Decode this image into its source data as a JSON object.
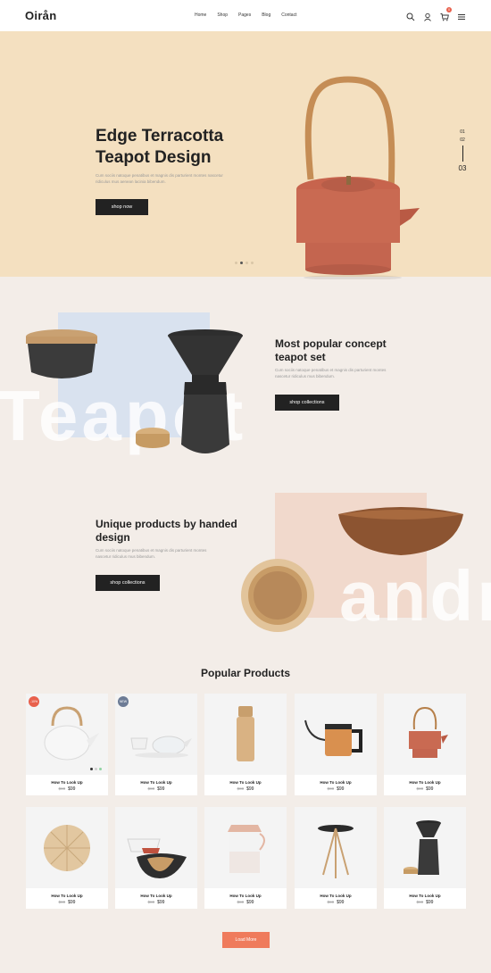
{
  "header": {
    "logo": "Oirån",
    "nav": [
      "Home",
      "Shop",
      "Pages",
      "Blog",
      "Contact"
    ],
    "cart_count": "0"
  },
  "hero": {
    "title": "Edge Terracotta Teapot Design",
    "description": "Cum sociis natoque penatibus et magnis dis parturient montes nascetur ridiculus mus aenean lacinia bibendum.",
    "button": "shop now",
    "slides": [
      "01",
      "02",
      "03"
    ],
    "active_slide": 2
  },
  "section_teapot": {
    "bg_word": "Teapot",
    "title": "Most popular concept teapot set",
    "description": "Cum sociis natoque penatibus et magnis dis parturient montes nascetur ridiculus mus bibendum.",
    "button": "shop collections"
  },
  "section_handed": {
    "bg_word": "andr",
    "title": "Unique products by handed design",
    "description": "Cum sociis natoque penatibus et magnis dis parturient montes nascetur ridiculus mus bibendum.",
    "button": "shop collections"
  },
  "products": {
    "title": "Popular Products",
    "items": [
      {
        "name": "How To Look Up",
        "old_price": "$80",
        "price": "$99",
        "badge": "-10%",
        "badge_color": "#e8604c",
        "image": "white-kettle"
      },
      {
        "name": "How To Look Up",
        "old_price": "$80",
        "price": "$99",
        "badge": "NEW",
        "badge_color": "#6c7b95",
        "image": "tea-set"
      },
      {
        "name": "How To Look Up",
        "old_price": "$80",
        "price": "$99",
        "image": "wood-grinder"
      },
      {
        "name": "How To Look Up",
        "old_price": "$80",
        "price": "$99",
        "image": "copper-kettle"
      },
      {
        "name": "How To Look Up",
        "old_price": "$80",
        "price": "$99",
        "image": "terracotta-teapot"
      },
      {
        "name": "How To Look Up",
        "old_price": "$80",
        "price": "$99",
        "image": "wood-board"
      },
      {
        "name": "How To Look Up",
        "old_price": "$80",
        "price": "$99",
        "image": "bowls"
      },
      {
        "name": "How To Look Up",
        "old_price": "$80",
        "price": "$99",
        "image": "jug"
      },
      {
        "name": "How To Look Up",
        "old_price": "$80",
        "price": "$99",
        "image": "side-table"
      },
      {
        "name": "How To Look Up",
        "old_price": "$80",
        "price": "$99",
        "image": "coffee-maker"
      }
    ],
    "load_more": "Load More"
  },
  "colors": {
    "accent": "#ef7b5c",
    "hero_bg": "#f4e0c0",
    "page_bg": "#f3ede8"
  }
}
